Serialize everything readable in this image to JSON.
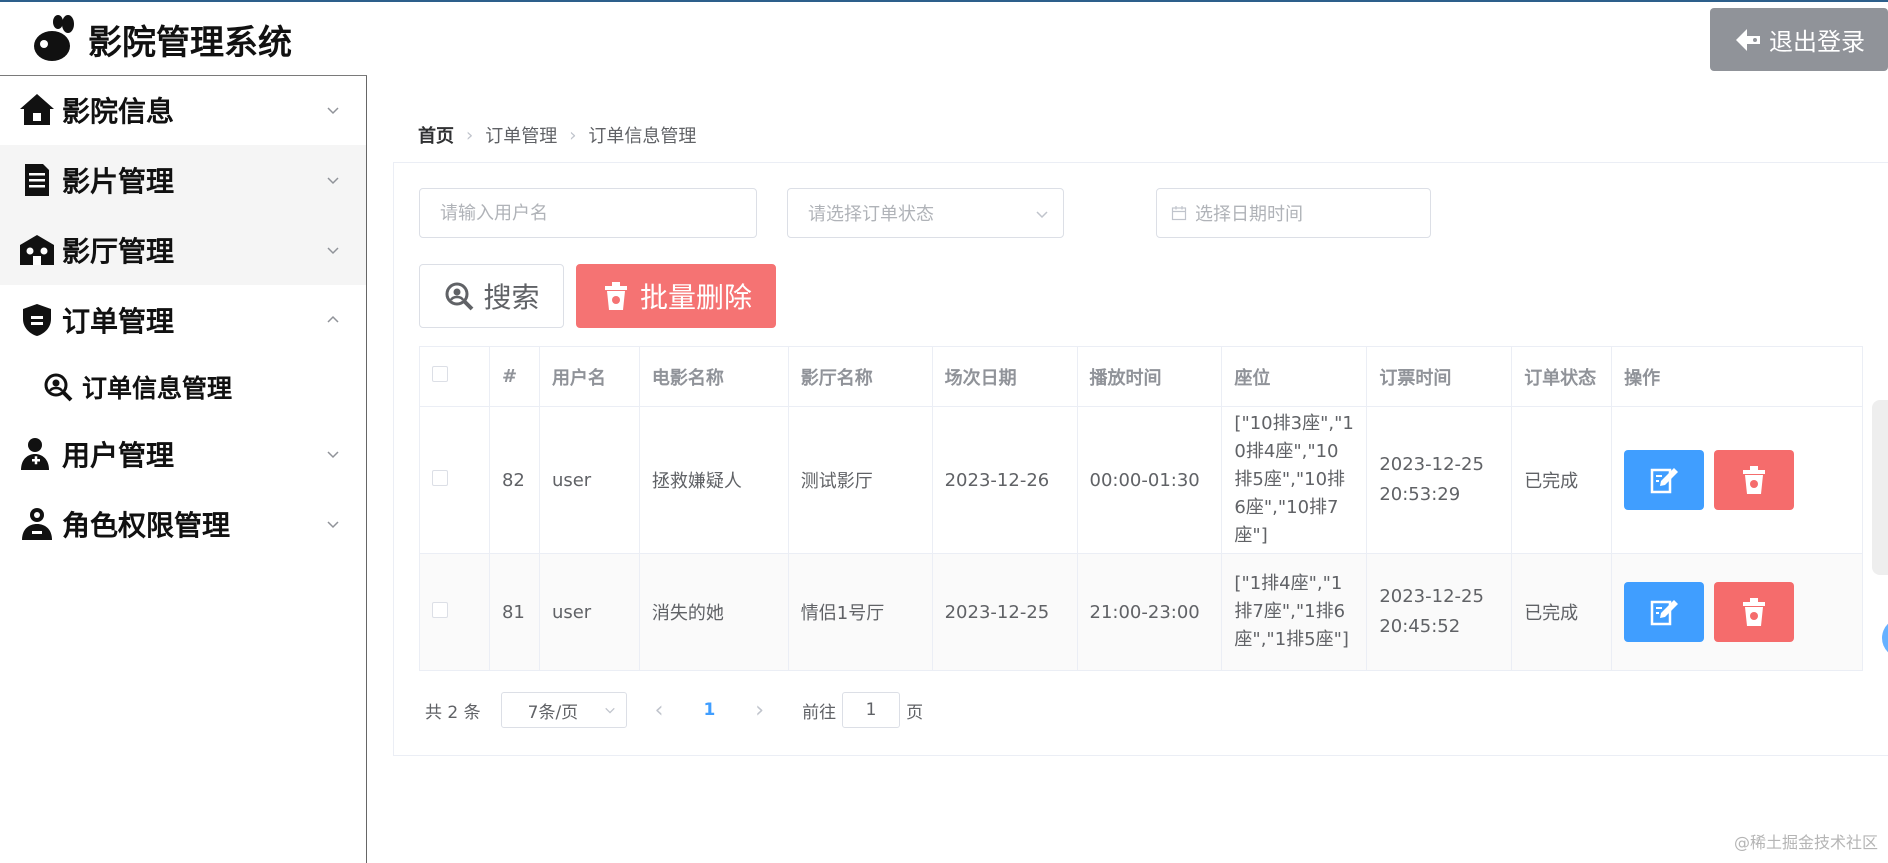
{
  "app": {
    "title": "影院管理系统",
    "logout_label": "退出登录"
  },
  "sidebar": {
    "items": [
      {
        "label": "影院信息",
        "icon": "home-icon",
        "expanded": false
      },
      {
        "label": "影片管理",
        "icon": "document-icon",
        "expanded": false
      },
      {
        "label": "影厅管理",
        "icon": "hall-icon",
        "expanded": false
      },
      {
        "label": "订单管理",
        "icon": "shield-icon",
        "expanded": true,
        "children": [
          {
            "label": "订单信息管理",
            "icon": "search-icon"
          }
        ]
      },
      {
        "label": "用户管理",
        "icon": "user-add-icon",
        "expanded": false
      },
      {
        "label": "角色权限管理",
        "icon": "user-role-icon",
        "expanded": false
      }
    ]
  },
  "breadcrumb": [
    "首页",
    "订单管理",
    "订单信息管理"
  ],
  "filters": {
    "username_placeholder": "请输入用户名",
    "status_placeholder": "请选择订单状态",
    "date_placeholder": "选择日期时间"
  },
  "actions": {
    "search_label": "搜索",
    "batch_delete_label": "批量删除"
  },
  "table": {
    "columns": [
      "#",
      "用户名",
      "电影名称",
      "影厅名称",
      "场次日期",
      "播放时间",
      "座位",
      "订票时间",
      "订单状态",
      "操作"
    ],
    "rows": [
      {
        "id": "82",
        "username": "user",
        "movie": "拯救嫌疑人",
        "hall": "测试影厅",
        "date": "2023-12-26",
        "time": "00:00-01:30",
        "seats": "[\"10排3座\",\"10排4座\",\"10排5座\",\"10排6座\",\"10排7座\"]",
        "order_time": "2023-12-25 20:53:29",
        "status": "已完成"
      },
      {
        "id": "81",
        "username": "user",
        "movie": "消失的她",
        "hall": "情侣1号厅",
        "date": "2023-12-25",
        "time": "21:00-23:00",
        "seats": "[\"1排4座\",\"1排7座\",\"1排6座\",\"1排5座\"]",
        "order_time": "2023-12-25 20:45:52",
        "status": "已完成"
      }
    ]
  },
  "pagination": {
    "total_label": "共 2 条",
    "page_size": "7条/页",
    "current_page": "1",
    "goto_label": "前往",
    "goto_value": "1",
    "page_suffix": "页"
  },
  "watermark": "@稀土掘金技术社区",
  "colors": {
    "primary": "#409eff",
    "danger": "#f56c6c",
    "success": "#67c23a",
    "info": "#909399"
  }
}
